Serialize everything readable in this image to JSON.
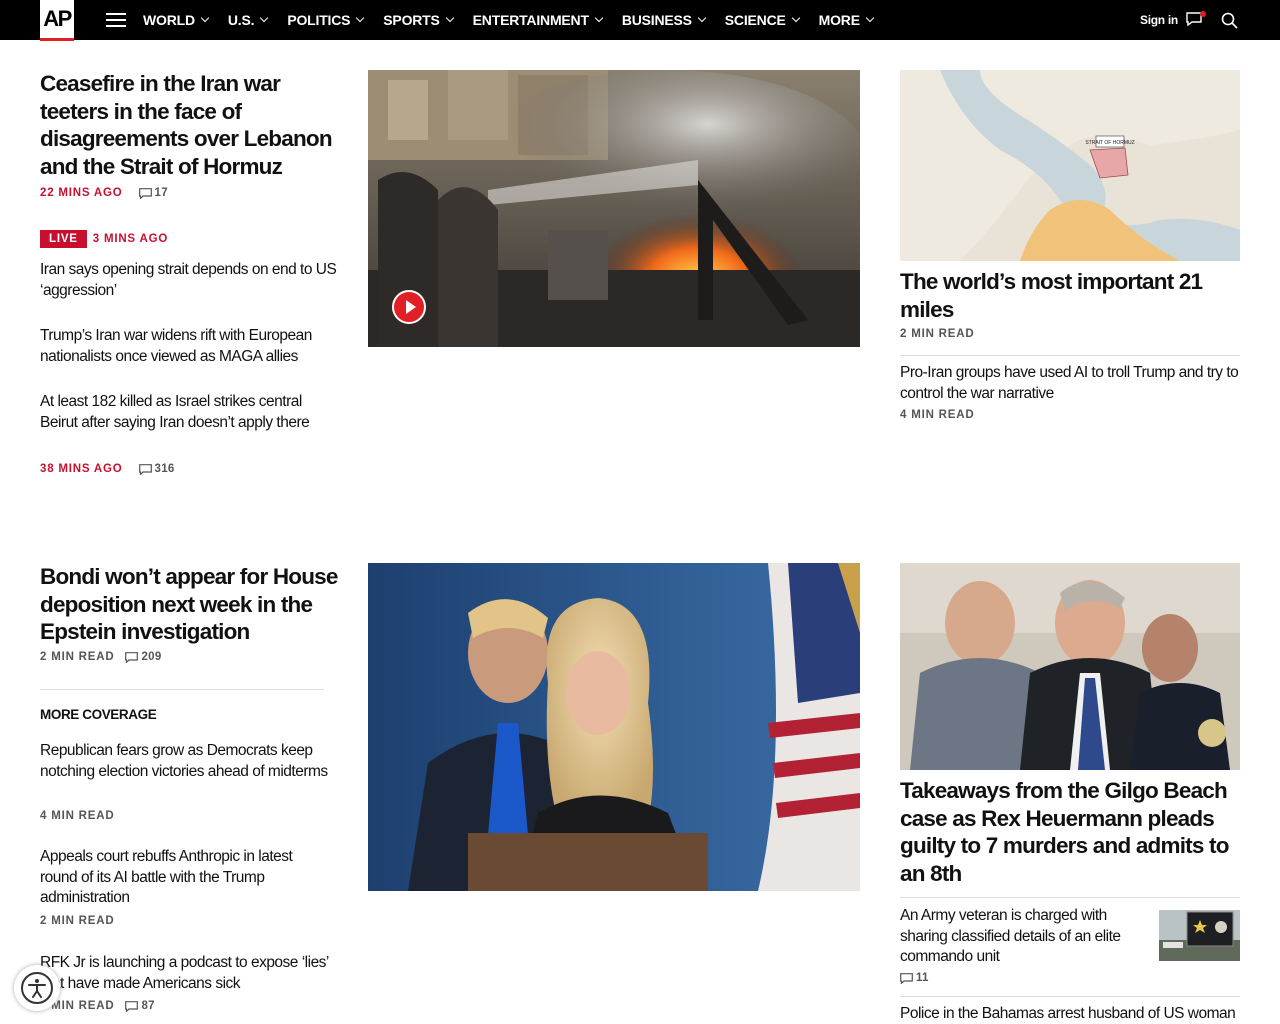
{
  "brand": {
    "logo_text": "AP",
    "accent": "#e01f26"
  },
  "nav": {
    "items": [
      {
        "label": "WORLD"
      },
      {
        "label": "U.S."
      },
      {
        "label": "POLITICS"
      },
      {
        "label": "SPORTS"
      },
      {
        "label": "ENTERTAINMENT"
      },
      {
        "label": "BUSINESS"
      },
      {
        "label": "SCIENCE"
      },
      {
        "label": "MORE"
      }
    ],
    "signin": "Sign in",
    "icons": [
      "hamburger-icon",
      "chat-icon",
      "search-icon"
    ]
  },
  "top": {
    "lead": {
      "headline": "Ceasefire in the Iran war teeters in the face of disagreements over Lebanon and the Strait of Hormuz",
      "time": "22 MINS AGO",
      "comments": "17"
    },
    "live": {
      "badge": "LIVE",
      "time": "3 MINS AGO"
    },
    "related": [
      {
        "headline": "Iran says opening strait depends on end to US ‘aggression’"
      },
      {
        "headline": "Trump’s Iran war widens rift with European nationalists once viewed as MAGA allies"
      },
      {
        "headline": "At least 182 killed as Israel strikes central Beirut after saying Iran doesn’t apply there",
        "time": "38 MINS AGO",
        "comments": "316"
      }
    ],
    "map_labels": {
      "strait": "STRAIT OF HORMUZ"
    },
    "right": {
      "headline": "The world’s most important 21 miles",
      "meta": "2 MIN READ",
      "secondary": {
        "headline": "Pro-Iran groups have used AI to troll Trump and try to control the war narrative",
        "meta": "4 MIN READ"
      }
    }
  },
  "second": {
    "lead": {
      "headline": "Bondi won’t appear for House deposition next week in the Epstein investigation",
      "meta": "2 MIN READ",
      "comments": "209"
    },
    "more_coverage_label": "MORE COVERAGE",
    "coverage": [
      {
        "headline": "Republican fears grow as Democrats keep notching election victories ahead of midterms",
        "meta": "4 MIN READ"
      },
      {
        "headline": "Appeals court rebuffs Anthropic in latest round of its AI battle with the Trump administration",
        "meta": "2 MIN READ"
      },
      {
        "headline": "RFK Jr is launching a podcast to expose ‘lies’ that have made Americans sick",
        "meta": "3 MIN READ",
        "comments": "87"
      }
    ],
    "right": {
      "headline": "Takeaways from the Gilgo Beach case as Rex Heuermann pleads guilty to 7 murders and admits to an 8th",
      "secondary": {
        "headline": "An Army veteran is charged with sharing classified details of an elite commando unit",
        "comments": "11"
      },
      "tertiary": {
        "headline": "Police in the Bahamas arrest husband of US woman"
      }
    }
  }
}
